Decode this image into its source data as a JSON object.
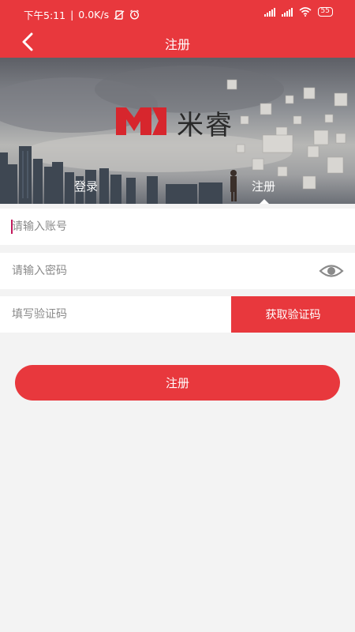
{
  "status_bar": {
    "time": "下午5:11",
    "network_speed": "0.0K/s",
    "battery": "55"
  },
  "header": {
    "title": "注册",
    "back_icon": "chevron-left-icon"
  },
  "banner": {
    "logo_text": "米睿",
    "tabs": [
      {
        "label": "登录",
        "active": false
      },
      {
        "label": "注册",
        "active": true
      }
    ]
  },
  "form": {
    "account_placeholder": "请输入账号",
    "password_placeholder": "请输入密码",
    "code_placeholder": "填写验证码",
    "get_code_label": "获取验证码",
    "eye_icon": "eye-icon"
  },
  "submit_label": "注册",
  "colors": {
    "accent": "#e8383d",
    "background": "#f3f3f3"
  }
}
